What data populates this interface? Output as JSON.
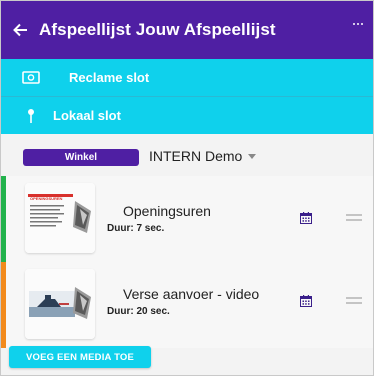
{
  "header": {
    "title": "Afspeellijst Jouw Afspeellijst",
    "back_icon": "arrow-left-icon",
    "menu_icon": "more-icon"
  },
  "slots": [
    {
      "label": "Reclame slot",
      "icon": "money-icon"
    },
    {
      "label": "Lokaal slot",
      "icon": "pin-icon"
    }
  ],
  "selector": {
    "badge": "Winkel",
    "value": "INTERN Demo"
  },
  "items": [
    {
      "name": "Openingsuren",
      "duration": "Duur: 7 sec.",
      "bar_color": "#22b24c",
      "thumb_text": "OPENINGSUREN"
    },
    {
      "name": "Verse aanvoer - video",
      "duration": "Duur: 20 sec.",
      "bar_color": "#f28a1c"
    }
  ],
  "add_button": {
    "label": "VOEG EEN MEDIA TOE"
  },
  "colors": {
    "header": "#4f1fa3",
    "accent": "#0fd1ec"
  }
}
